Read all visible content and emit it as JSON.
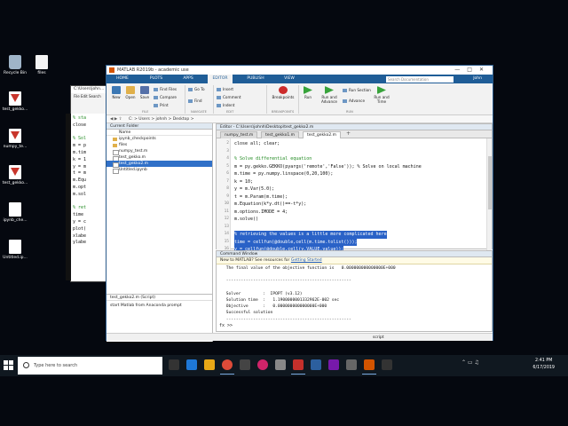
{
  "desktop": {
    "icons": [
      {
        "label": "Recycle Bin",
        "icon": "recycle-bin-icon"
      },
      {
        "label": "files",
        "icon": "folder-icon"
      },
      {
        "label": "test_gekko...",
        "icon": "pdf-file-icon"
      },
      {
        "label": "numpy_te...",
        "icon": "pdf-file-icon"
      },
      {
        "label": "test_gekko...",
        "icon": "pdf-file-icon"
      },
      {
        "label": "ipynb_che...",
        "icon": "file-icon"
      },
      {
        "label": "Untitled.ip...",
        "icon": "file-icon"
      }
    ]
  },
  "background_window": {
    "title": "C:\\Users\\john...",
    "menu": "File  Edit  Search",
    "code_fragments": [
      "% sta",
      "close",
      "",
      "% Sol",
      "m = p",
      "m.tim",
      "k = 1",
      "y = m",
      "t = m",
      "m.Equ",
      "m.opt",
      "m.sol",
      "",
      "% ret",
      "time",
      "y = c",
      "plot(",
      "xlabe",
      "ylabe"
    ]
  },
  "matlab": {
    "title": "MATLAB R2019b - academic use",
    "tabs": [
      "HOME",
      "PLOTS",
      "APPS",
      "EDITOR",
      "PUBLISH",
      "VIEW"
    ],
    "active_tab": "EDITOR",
    "search_placeholder": "Search Documentation",
    "user": "John",
    "ribbon": {
      "file": {
        "new": "New",
        "open": "Open",
        "save": "Save",
        "find_files": "Find Files",
        "compare": "Compare",
        "print": "Print",
        "section": "FILE"
      },
      "navigate": {
        "insert": "Insert",
        "comment": "Comment",
        "indent": "Indent",
        "goto": "Go To",
        "find": "Find",
        "section": "NAVIGATE"
      },
      "edit": {
        "section": "EDIT"
      },
      "breakpoints": {
        "label": "Breakpoints",
        "section": "BREAKPOINTS"
      },
      "run": {
        "run": "Run",
        "run_advance": "Run and Advance",
        "run_section": "Run Section",
        "advance": "Advance",
        "run_time": "Run and Time",
        "section": "RUN"
      }
    },
    "address": "C: > Users > johnh > Desktop >",
    "current_folder": {
      "title": "Current Folder",
      "column": "Name",
      "items": [
        {
          "name": "ipynb_checkpoints",
          "type": "folder"
        },
        {
          "name": "files",
          "type": "folder"
        },
        {
          "name": "numpy_test.m",
          "type": "file"
        },
        {
          "name": "test_gekko.m",
          "type": "file"
        },
        {
          "name": "test_gekko2.m",
          "type": "file",
          "selected": true
        },
        {
          "name": "Untitled.ipynb",
          "type": "file"
        }
      ],
      "details_title": "test_gekko2.m (Script)",
      "details_text": "start Matlab from Anaconda prompt"
    },
    "editor": {
      "title": "Editor - C:\\Users\\johnh\\Desktop\\test_gekko2.m",
      "tabs": [
        "numpy_test.m",
        "test_gekko1.m",
        "test_gekko2.m"
      ],
      "active_tab": "test_gekko2.m",
      "lines": [
        {
          "n": "2",
          "text": "close all; clear;",
          "kind": "code"
        },
        {
          "n": "3",
          "text": "",
          "kind": "code"
        },
        {
          "n": "4",
          "text": "% Solve differential equation",
          "kind": "comment"
        },
        {
          "n": "5",
          "text": "m = py.gekko.GEKKO(pyargs('remote','False')); % Solve on local machine",
          "kind": "code"
        },
        {
          "n": "6",
          "text": "m.time = py.numpy.linspace(0,20,100);",
          "kind": "code"
        },
        {
          "n": "7",
          "text": "k = 10;",
          "kind": "code"
        },
        {
          "n": "8",
          "text": "y = m.Var(5.0);",
          "kind": "code"
        },
        {
          "n": "9",
          "text": "t = m.Param(m.time);",
          "kind": "code"
        },
        {
          "n": "10",
          "text": "m.Equation(k*y.dt()==-t*y);",
          "kind": "code"
        },
        {
          "n": "11",
          "text": "m.options.IMODE = 4;",
          "kind": "code"
        },
        {
          "n": "12",
          "text": "m.solve()",
          "kind": "code"
        },
        {
          "n": "13",
          "text": "",
          "kind": "code"
        },
        {
          "n": "14",
          "text": "% retrieving the values is a little more complicated here",
          "kind": "selected"
        },
        {
          "n": "15",
          "text": "time = cellfun(@double,cell(m.time.tolist()));",
          "kind": "selected"
        },
        {
          "n": "16",
          "text": "y = cellfun(@double,cell(y.VALUE.value));",
          "kind": "selected"
        },
        {
          "n": "17",
          "text": "plot(time,y)",
          "kind": "code"
        }
      ]
    },
    "command_window": {
      "title": "Command Window",
      "info_text": "New to MATLAB? See resources for ",
      "info_link": "Getting Started",
      "output": [
        " The final value of the objective function is   0.000000000000000E+000",
        "",
        " ---------------------------------------------------",
        "",
        " Solver         :  IPOPT (v3.12)",
        " Solution time  :   1.1900000001332962E-002 sec",
        " Objective      :   0.000000000000000E+000",
        " Successful solution",
        " ---------------------------------------------------"
      ],
      "prompt": "fx >>"
    },
    "status_text": "script"
  },
  "taskbar": {
    "search_placeholder": "Type here to search",
    "time": "2:41 PM",
    "date": "6/17/2019"
  }
}
